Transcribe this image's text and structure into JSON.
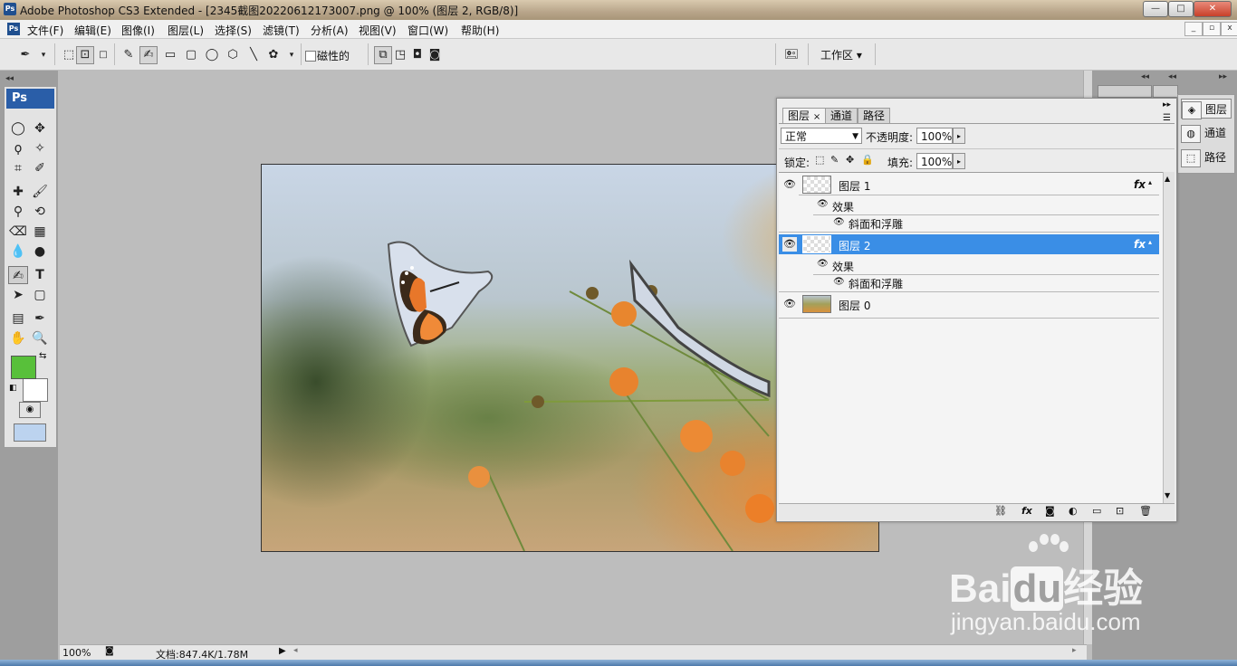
{
  "window": {
    "title": "Adobe Photoshop CS3 Extended - [2345截图20220612173007.png @ 100% (图层 2, RGB/8)]",
    "app_icon": "Ps",
    "min_glyph": "—",
    "max_glyph": "□",
    "close_glyph": "✕"
  },
  "menu": {
    "items": [
      "文件(F)",
      "编辑(E)",
      "图像(I)",
      "图层(L)",
      "选择(S)",
      "滤镜(T)",
      "分析(A)",
      "视图(V)",
      "窗口(W)",
      "帮助(H)"
    ],
    "doc_min": "_",
    "doc_restore": "▫",
    "doc_close": "x"
  },
  "options_bar": {
    "magnetic_label": "磁性的",
    "workspace_label": "工作区 ▾"
  },
  "toolbox": {
    "logo": "Ps",
    "foreground_color": "#58c03a",
    "background_color": "#ffffff"
  },
  "status": {
    "zoom": "100%",
    "doc_info": "文档:847.4K/1.78M"
  },
  "layers_panel": {
    "tabs": [
      "图层",
      "通道",
      "路径"
    ],
    "blend_mode": "正常",
    "opacity_label": "不透明度:",
    "opacity_value": "100%",
    "lock_label": "锁定:",
    "fill_label": "填充:",
    "fill_value": "100%",
    "layers": [
      {
        "name": "图层 1",
        "selected": false,
        "fx": "fx",
        "effects_label": "效果",
        "effect": "斜面和浮雕"
      },
      {
        "name": "图层 2",
        "selected": true,
        "fx": "fx",
        "effects_label": "效果",
        "effect": "斜面和浮雕"
      },
      {
        "name": "图层 0",
        "selected": false
      }
    ]
  },
  "dock": {
    "items": [
      "图层",
      "通道",
      "路径"
    ]
  },
  "watermark": {
    "brand": "Bai",
    "brand2": "du",
    "cn": "经验",
    "url": "jingyan.baidu.com"
  }
}
